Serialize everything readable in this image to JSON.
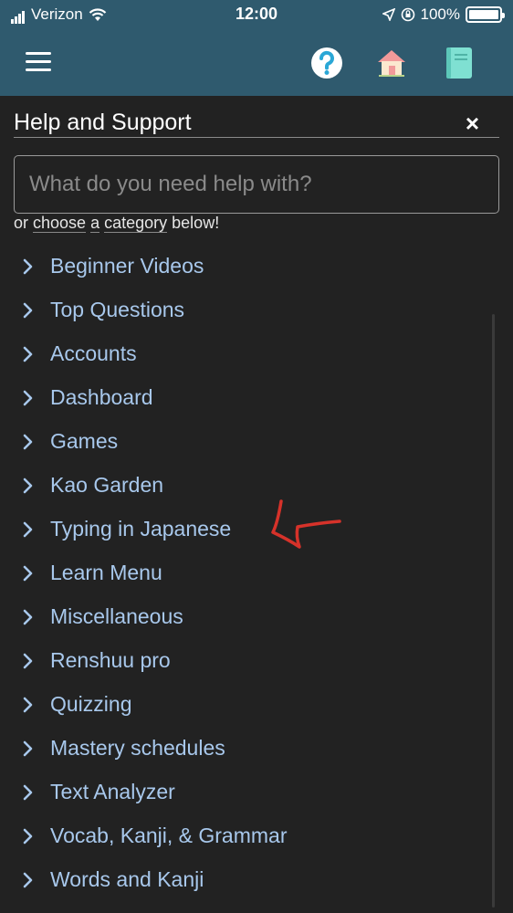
{
  "status_bar": {
    "carrier": "Verizon",
    "time": "12:00",
    "battery": "100%"
  },
  "header": {
    "menu_icon": "hamburger-icon",
    "help_icon": "question-icon",
    "home_icon": "home-icon",
    "book_icon": "book-icon"
  },
  "panel": {
    "title": "Help and Support",
    "close_label": "×",
    "search_placeholder": "What do you need help with?",
    "choose_prefix": "or ",
    "choose_word": "choose",
    "choose_middle": " ",
    "choose_a": "a",
    "choose_space": " ",
    "choose_category": "category",
    "choose_suffix": " below!"
  },
  "categories": [
    {
      "label": "Beginner Videos"
    },
    {
      "label": "Top Questions"
    },
    {
      "label": "Accounts"
    },
    {
      "label": "Dashboard"
    },
    {
      "label": "Games"
    },
    {
      "label": "Kao Garden"
    },
    {
      "label": "Typing in Japanese"
    },
    {
      "label": "Learn Menu"
    },
    {
      "label": "Miscellaneous"
    },
    {
      "label": "Renshuu pro"
    },
    {
      "label": "Quizzing"
    },
    {
      "label": "Mastery schedules"
    },
    {
      "label": "Text Analyzer"
    },
    {
      "label": "Vocab, Kanji, & Grammar"
    },
    {
      "label": "Words and Kanji"
    }
  ],
  "colors": {
    "header_bg": "#2f5a6e",
    "page_bg": "#222222",
    "link": "#a8c8ec",
    "annotation": "#d6322a"
  }
}
